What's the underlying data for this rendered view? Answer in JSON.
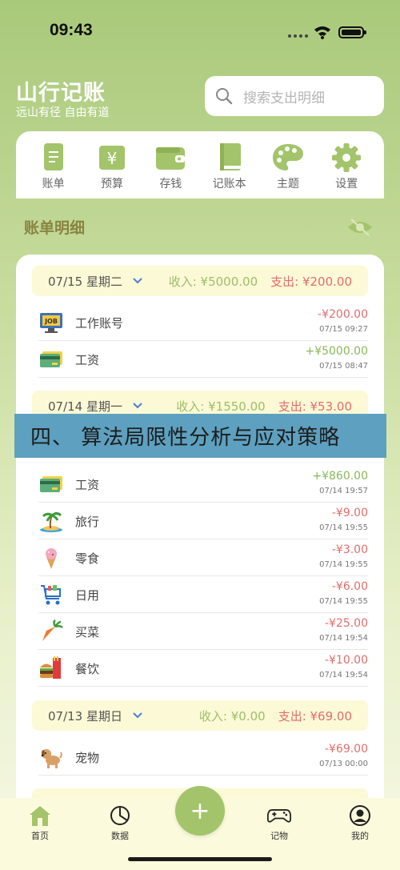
{
  "status_bar": {
    "time": "09:43"
  },
  "header": {
    "title": "山行记账",
    "subtitle": "远山有径 自由有道",
    "search_placeholder": "搜索支出明细"
  },
  "shortcuts": [
    {
      "label": "账单",
      "icon": "bill-icon"
    },
    {
      "label": "预算",
      "icon": "budget-icon"
    },
    {
      "label": "存钱",
      "icon": "wallet-icon"
    },
    {
      "label": "记账本",
      "icon": "book-icon"
    },
    {
      "label": "主题",
      "icon": "palette-icon"
    },
    {
      "label": "设置",
      "icon": "gear-icon"
    }
  ],
  "section": {
    "title": "账单明细"
  },
  "days": [
    {
      "date": "07/15 星期二",
      "income": "收入: ¥5000.00",
      "expense": "支出: ¥200.00",
      "entries": [
        {
          "name": "工作账号",
          "amount": "-¥200.00",
          "time": "07/15 09:27",
          "icon": "job-monitor-icon"
        },
        {
          "name": "工资",
          "amount": "+¥5000.00",
          "time": "07/15 08:47",
          "icon": "salary-card-icon"
        }
      ]
    },
    {
      "date": "07/14 星期一",
      "income": "收入: ¥1550.00",
      "expense": "支出: ¥53.00",
      "entries": [
        {
          "name": "工资",
          "amount": "+¥860.00",
          "time": "07/14 19:57",
          "icon": "salary-card-icon"
        },
        {
          "name": "旅行",
          "amount": "-¥9.00",
          "time": "07/14 19:55",
          "icon": "island-icon"
        },
        {
          "name": "零食",
          "amount": "-¥3.00",
          "time": "07/14 19:55",
          "icon": "ice-cream-icon"
        },
        {
          "name": "日用",
          "amount": "-¥6.00",
          "time": "07/14 19:55",
          "icon": "shopping-cart-icon"
        },
        {
          "name": "买菜",
          "amount": "-¥25.00",
          "time": "07/14 19:54",
          "icon": "carrot-icon"
        },
        {
          "name": "餐饮",
          "amount": "-¥10.00",
          "time": "07/14 19:54",
          "icon": "burger-icon"
        }
      ]
    },
    {
      "date": "07/13 星期日",
      "income": "收入: ¥0.00",
      "expense": "支出: ¥69.00",
      "entries": [
        {
          "name": "宠物",
          "amount": "-¥69.00",
          "time": "07/13 00:00",
          "icon": "dog-icon"
        }
      ]
    }
  ],
  "banner": {
    "text": "四、 算法局限性分析与应对策略"
  },
  "tabs": [
    {
      "label": "首页",
      "icon": "home-icon"
    },
    {
      "label": "数据",
      "icon": "pie-chart-icon"
    },
    {
      "label": "记物",
      "icon": "gamepad-icon"
    },
    {
      "label": "我的",
      "icon": "profile-icon"
    }
  ],
  "fab": {
    "label": "+"
  },
  "colors": {
    "accent": "#a3c46a",
    "expense": "#e26d6d",
    "income": "#8ab85a",
    "banner": "#5da0bf"
  }
}
